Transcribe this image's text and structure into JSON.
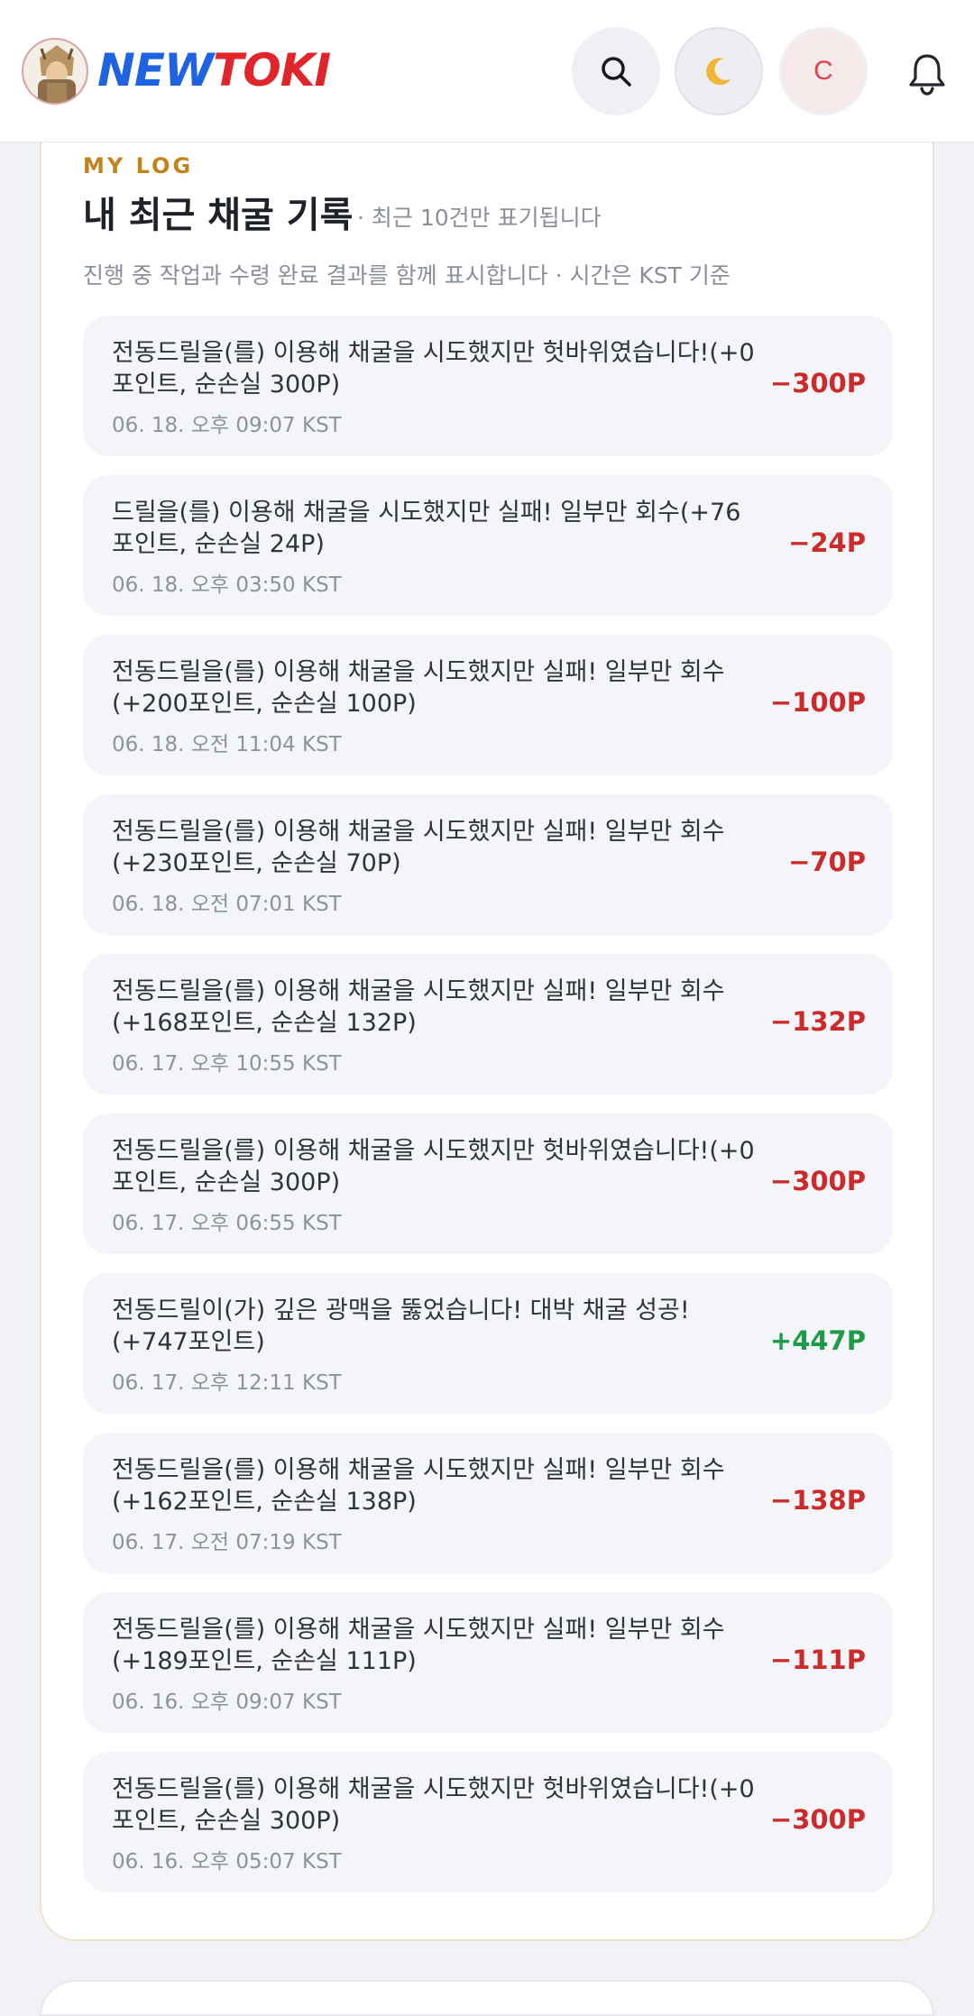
{
  "header": {
    "brand_new": "NEW",
    "brand_toki": "TOKI",
    "search_icon": "search-icon",
    "theme_icon": "moon-icon",
    "user_initial": "C",
    "bell_icon": "bell-icon"
  },
  "log": {
    "eyebrow": "MY LOG",
    "title": "내 최근 채굴 기록",
    "title_note": "· 최근 10건만 표기됩니다",
    "subtitle": "진행 중 작업과 수령 완료 결과를 함께 표시합니다 · 시간은 KST 기준",
    "items": [
      {
        "text": "전동드릴을(를) 이용해 채굴을 시도했지만 헛바위였습니다!(+0 포인트, 순손실 300P)",
        "time": "06. 18. 오후 09:07 KST",
        "amount": "−300P",
        "sign": "neg"
      },
      {
        "text": "드릴을(를) 이용해 채굴을 시도했지만 실패! 일부만 회수(+76포인트, 순손실 24P)",
        "time": "06. 18. 오후 03:50 KST",
        "amount": "−24P",
        "sign": "neg"
      },
      {
        "text": "전동드릴을(를) 이용해 채굴을 시도했지만 실패! 일부만 회수(+200포인트, 순손실 100P)",
        "time": "06. 18. 오전 11:04 KST",
        "amount": "−100P",
        "sign": "neg"
      },
      {
        "text": "전동드릴을(를) 이용해 채굴을 시도했지만 실패! 일부만 회수(+230포인트, 순손실 70P)",
        "time": "06. 18. 오전 07:01 KST",
        "amount": "−70P",
        "sign": "neg"
      },
      {
        "text": "전동드릴을(를) 이용해 채굴을 시도했지만 실패! 일부만 회수(+168포인트, 순손실 132P)",
        "time": "06. 17. 오후 10:55 KST",
        "amount": "−132P",
        "sign": "neg"
      },
      {
        "text": "전동드릴을(를) 이용해 채굴을 시도했지만 헛바위였습니다!(+0 포인트, 순손실 300P)",
        "time": "06. 17. 오후 06:55 KST",
        "amount": "−300P",
        "sign": "neg"
      },
      {
        "text": "전동드릴이(가) 깊은 광맥을 뚫었습니다! 대박 채굴 성공!(+747포인트)",
        "time": "06. 17. 오후 12:11 KST",
        "amount": "+447P",
        "sign": "pos"
      },
      {
        "text": "전동드릴을(를) 이용해 채굴을 시도했지만 실패! 일부만 회수(+162포인트, 순손실 138P)",
        "time": "06. 17. 오전 07:19 KST",
        "amount": "−138P",
        "sign": "neg"
      },
      {
        "text": "전동드릴을(를) 이용해 채굴을 시도했지만 실패! 일부만 회수(+189포인트, 순손실 111P)",
        "time": "06. 16. 오후 09:07 KST",
        "amount": "−111P",
        "sign": "neg"
      },
      {
        "text": "전동드릴을(를) 이용해 채굴을 시도했지만 헛바위였습니다!(+0 포인트, 순손실 300P)",
        "time": "06. 16. 오후 05:07 KST",
        "amount": "−300P",
        "sign": "neg"
      }
    ]
  }
}
